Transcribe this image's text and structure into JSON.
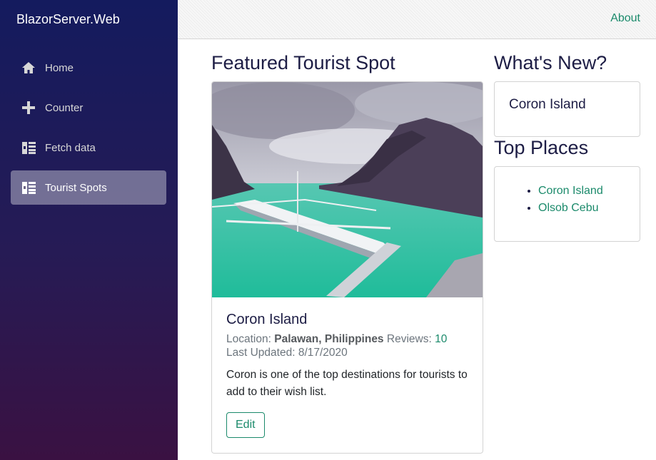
{
  "brand": "BlazorServer.Web",
  "nav": {
    "items": [
      {
        "label": "Home",
        "icon": "home-icon",
        "active": false
      },
      {
        "label": "Counter",
        "icon": "plus-icon",
        "active": false
      },
      {
        "label": "Fetch data",
        "icon": "list-icon",
        "active": false
      },
      {
        "label": "Tourist Spots",
        "icon": "list-icon",
        "active": true
      }
    ]
  },
  "topbar": {
    "about": "About"
  },
  "featured": {
    "heading": "Featured Tourist Spot",
    "title": "Coron Island",
    "location_label": "Location:",
    "location": "Palawan, Philippines",
    "reviews_label": "Reviews:",
    "reviews": "10",
    "updated_label": "Last Updated:",
    "updated": "8/17/2020",
    "description": "Coron is one of the top destinations for tourists to add to their wish list.",
    "edit_label": "Edit"
  },
  "whats_new": {
    "heading": "What's New?",
    "item": "Coron Island"
  },
  "top_places": {
    "heading": "Top Places",
    "items": [
      "Coron Island",
      "Olsob Cebu"
    ]
  },
  "colors": {
    "accent": "#1b8a6b",
    "sidebar_top": "#141b5e",
    "sidebar_bottom": "#3a1142",
    "heading": "#1d1d45"
  }
}
